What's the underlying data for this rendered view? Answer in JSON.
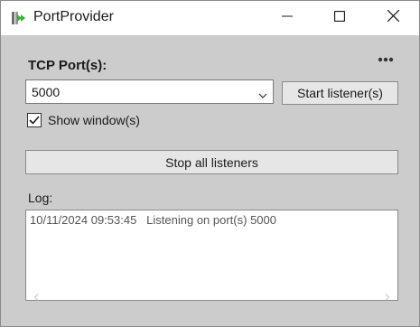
{
  "window": {
    "title": "PortProvider",
    "icon": "port-provider-app-icon",
    "controls": [
      "minimize-icon",
      "maximize-icon",
      "close-icon"
    ]
  },
  "toolbar": {
    "more_icon": "more-horizontal-icon"
  },
  "form": {
    "tcp_label": "TCP Port(s):",
    "port_value": "5000",
    "start_button": "Start listener(s)",
    "show_window_label": "Show window(s)",
    "show_window_checked": true,
    "stop_button": "Stop all listeners"
  },
  "log": {
    "label": "Log:",
    "entries": [
      {
        "timestamp": "10/11/2024 09:53:45",
        "message": "Listening on port(s) 5000"
      }
    ]
  },
  "colors": {
    "window_bg": "#cccccc",
    "titlebar_bg": "#ffffff",
    "button_bg": "#e6e6e6",
    "icon_green": "#2fb52f"
  }
}
